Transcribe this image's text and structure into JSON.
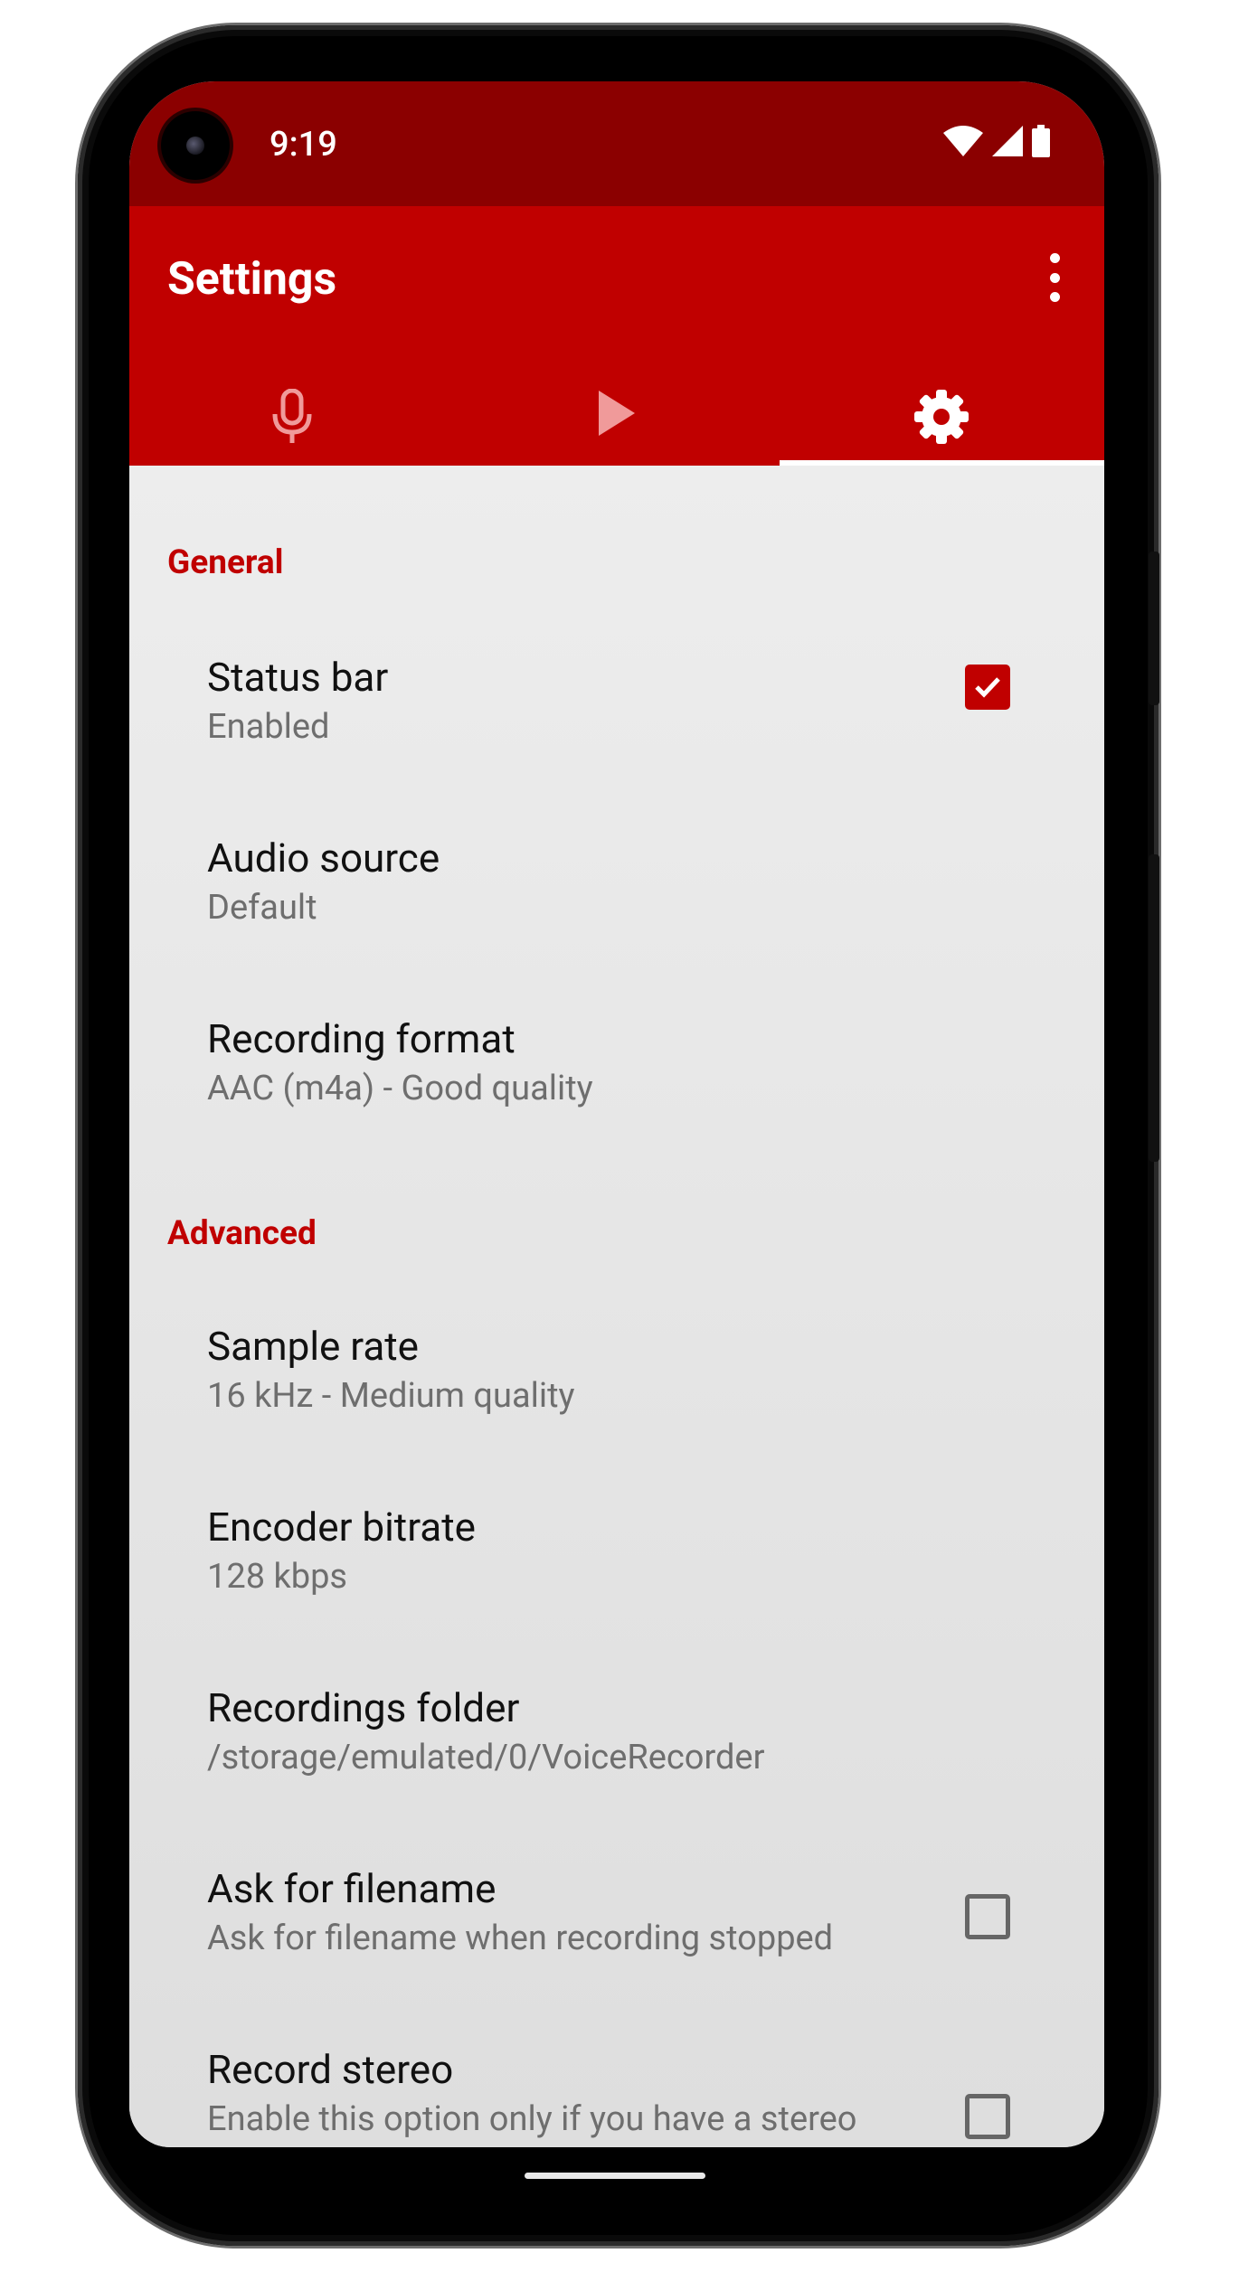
{
  "status_bar": {
    "time": "9:19",
    "icons": [
      "wifi-icon",
      "signal-icon",
      "battery-icon"
    ]
  },
  "app_bar": {
    "title": "Settings",
    "menu_icon": "more-vert-icon"
  },
  "tabs": [
    {
      "icon": "microphone-icon",
      "active": false
    },
    {
      "icon": "play-icon",
      "active": false
    },
    {
      "icon": "gear-icon",
      "active": true
    }
  ],
  "sections": {
    "general": "General",
    "advanced": "Advanced"
  },
  "settings": {
    "status_bar": {
      "title": "Status bar",
      "summary": "Enabled",
      "checked": true
    },
    "audio_source": {
      "title": "Audio source",
      "summary": "Default"
    },
    "recording_format": {
      "title": "Recording format",
      "summary": "AAC (m4a) - Good quality"
    },
    "sample_rate": {
      "title": "Sample rate",
      "summary": "16 kHz - Medium quality"
    },
    "encoder_bitrate": {
      "title": "Encoder bitrate",
      "summary": "128 kbps"
    },
    "recordings_folder": {
      "title": "Recordings folder",
      "summary": "/storage/emulated/0/VoiceRecorder"
    },
    "ask_filename": {
      "title": "Ask for filename",
      "summary": "Ask for filename when recording stopped",
      "checked": false
    },
    "record_stereo": {
      "title": "Record stereo",
      "summary": "Enable this option only if you have a stereo microphone",
      "checked": false
    }
  },
  "colors": {
    "status_bar": "#8b0000",
    "app_bar": "#c00000",
    "accent": "#c00000",
    "background": "#ebebeb"
  }
}
